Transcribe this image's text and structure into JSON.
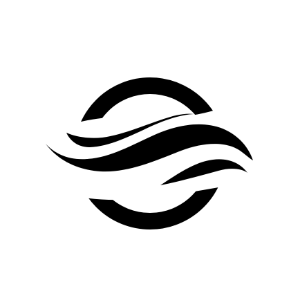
{
  "logo": {
    "icon": "wave-circle-logo",
    "colors": {
      "mark": "#000000",
      "background": "#ffffff"
    }
  }
}
